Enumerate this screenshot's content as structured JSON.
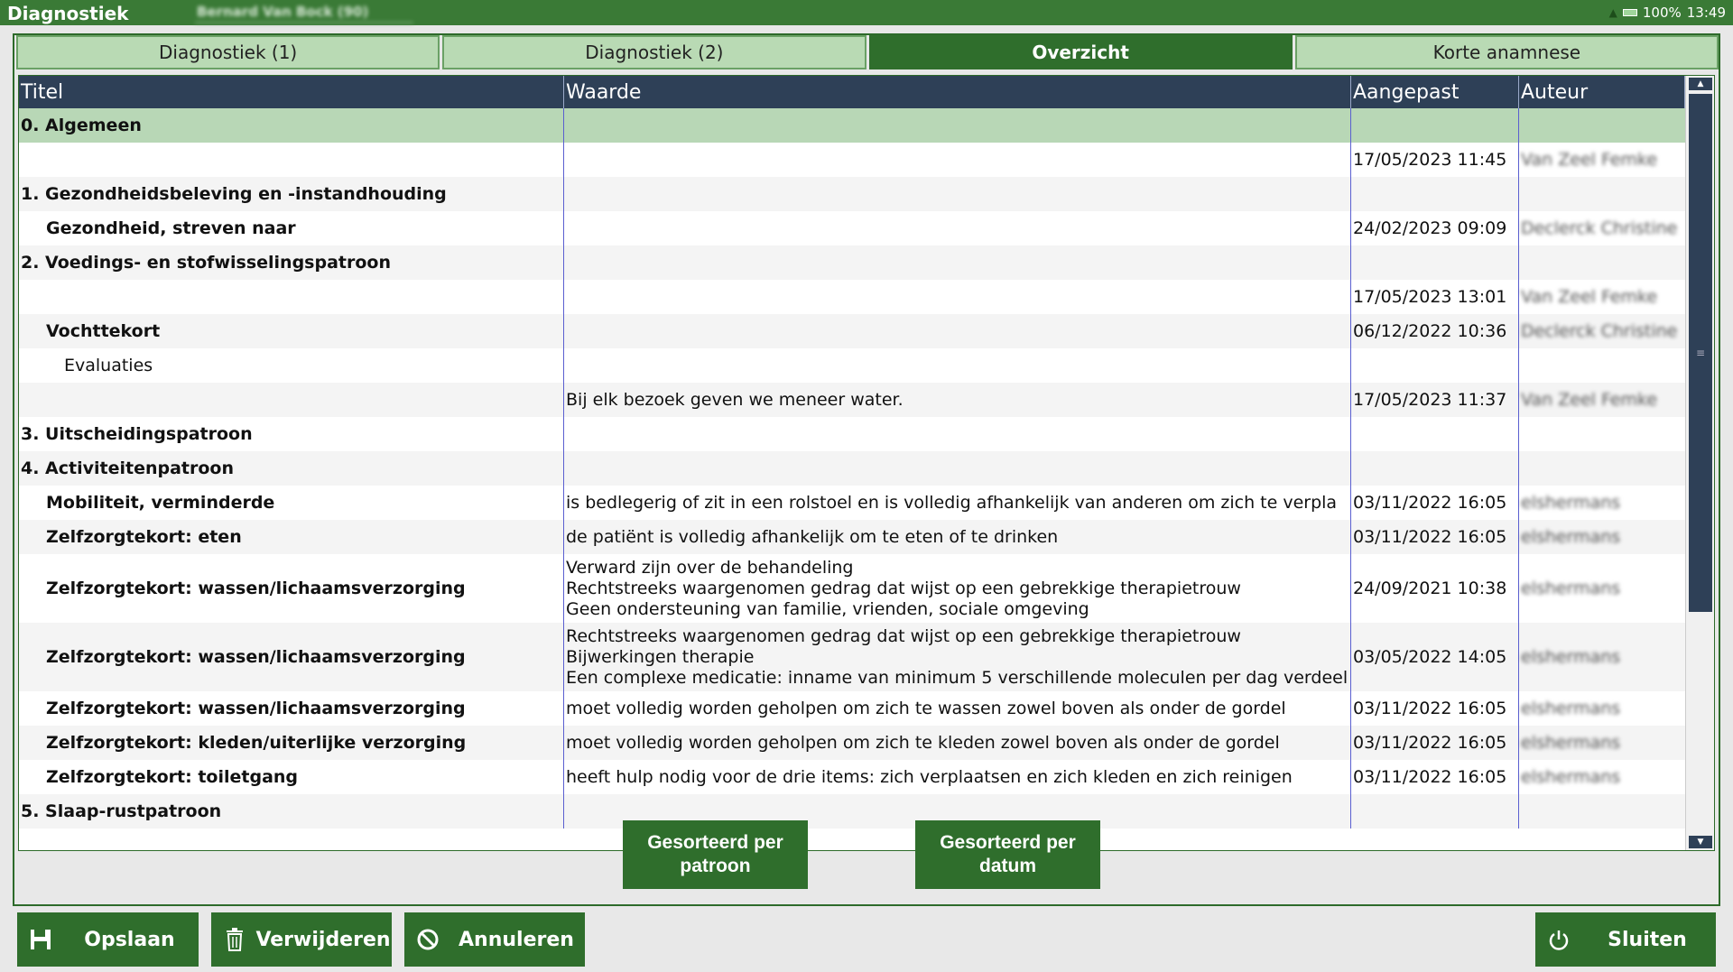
{
  "app": {
    "title": "Diagnostiek",
    "patient": "Bernard Van Bock (90)",
    "status_battery": "100%",
    "status_time": "13:49"
  },
  "tabs": [
    {
      "label": "Diagnostiek (1)",
      "active": false
    },
    {
      "label": "Diagnostiek (2)",
      "active": false
    },
    {
      "label": "Overzicht",
      "active": true
    },
    {
      "label": "Korte anamnese",
      "active": false
    }
  ],
  "table": {
    "headers": [
      "Titel",
      "Waarde",
      "Aangepast",
      "Auteur"
    ],
    "rows": [
      {
        "titel": "0. Algemeen",
        "waarde": "",
        "aangepast": "",
        "auteur": ""
      },
      {
        "titel": "",
        "waarde": "",
        "aangepast": "17/05/2023 11:45",
        "auteur": "Van Zeel Femke"
      },
      {
        "titel": "1. Gezondheidsbeleving en -instandhouding",
        "waarde": "",
        "aangepast": "",
        "auteur": ""
      },
      {
        "titel": "Gezondheid, streven naar",
        "waarde": "",
        "aangepast": "24/02/2023 09:09",
        "auteur": "Declerck Christine"
      },
      {
        "titel": "2. Voedings- en stofwisselingspatroon",
        "waarde": "",
        "aangepast": "",
        "auteur": ""
      },
      {
        "titel": "",
        "waarde": "",
        "aangepast": "17/05/2023 13:01",
        "auteur": "Van Zeel Femke"
      },
      {
        "titel": "Vochttekort",
        "waarde": "",
        "aangepast": "06/12/2022 10:36",
        "auteur": "Declerck Christine"
      },
      {
        "titel": "Evaluaties",
        "waarde": "",
        "aangepast": "",
        "auteur": ""
      },
      {
        "titel": "",
        "waarde": "Bij elk bezoek geven we meneer water.",
        "aangepast": "17/05/2023 11:37",
        "auteur": "Van Zeel Femke"
      },
      {
        "titel": "3. Uitscheidingspatroon",
        "waarde": "",
        "aangepast": "",
        "auteur": ""
      },
      {
        "titel": "4. Activiteitenpatroon",
        "waarde": "",
        "aangepast": "",
        "auteur": ""
      },
      {
        "titel": "Mobiliteit, verminderde",
        "waarde": "is bedlegerig of zit in een rolstoel en is volledig afhankelijk van anderen om zich te verpla",
        "aangepast": "03/11/2022 16:05",
        "auteur": "elshermans"
      },
      {
        "titel": "Zelfzorgtekort: eten",
        "waarde": "de patiënt is volledig afhankelijk om te eten of te drinken",
        "aangepast": "03/11/2022 16:05",
        "auteur": "elshermans"
      },
      {
        "titel": "Zelfzorgtekort: wassen/lichaamsverzorging",
        "waarde_lines": [
          "Verward zijn over de behandeling",
          "Rechtstreeks waargenomen gedrag dat wijst op een gebrekkige therapietrouw",
          "Geen ondersteuning van familie, vrienden, sociale omgeving"
        ],
        "aangepast": "24/09/2021 10:38",
        "auteur": "elshermans"
      },
      {
        "titel": "Zelfzorgtekort: wassen/lichaamsverzorging",
        "waarde_lines": [
          "Rechtstreeks waargenomen gedrag dat wijst op een gebrekkige therapietrouw",
          "Bijwerkingen therapie",
          "Een complexe medicatie: inname van minimum 5 verschillende moleculen per dag verdeel"
        ],
        "aangepast": "03/05/2022 14:05",
        "auteur": "elshermans"
      },
      {
        "titel": "Zelfzorgtekort: wassen/lichaamsverzorging",
        "waarde": "moet volledig worden geholpen om zich te wassen zowel boven als onder de gordel",
        "aangepast": "03/11/2022 16:05",
        "auteur": "elshermans"
      },
      {
        "titel": "Zelfzorgtekort: kleden/uiterlijke verzorging",
        "waarde": "moet volledig worden geholpen om zich te kleden zowel boven als onder de gordel",
        "aangepast": "03/11/2022 16:05",
        "auteur": "elshermans"
      },
      {
        "titel": "Zelfzorgtekort: toiletgang",
        "waarde": "heeft hulp nodig voor de drie items: zich verplaatsen en zich kleden en zich reinigen",
        "aangepast": "03/11/2022 16:05",
        "auteur": "elshermans"
      },
      {
        "titel": "5. Slaap-rustpatroon",
        "waarde": "",
        "aangepast": "",
        "auteur": ""
      }
    ]
  },
  "buttons": {
    "sort_pattern_line1": "Gesorteerd per",
    "sort_pattern_line2": "patroon",
    "sort_date_line1": "Gesorteerd per",
    "sort_date_line2": "datum",
    "save": "Opslaan",
    "delete": "Verwijderen",
    "cancel": "Annuleren",
    "close": "Sluiten"
  },
  "colors": {
    "brand_green": "#2f6e2c",
    "header_navy": "#2e4057",
    "group_row": "#b8d7b6"
  },
  "icons": {
    "save": "floppy-disk-icon",
    "delete": "trash-icon",
    "cancel": "no-entry-icon",
    "close": "power-icon"
  }
}
